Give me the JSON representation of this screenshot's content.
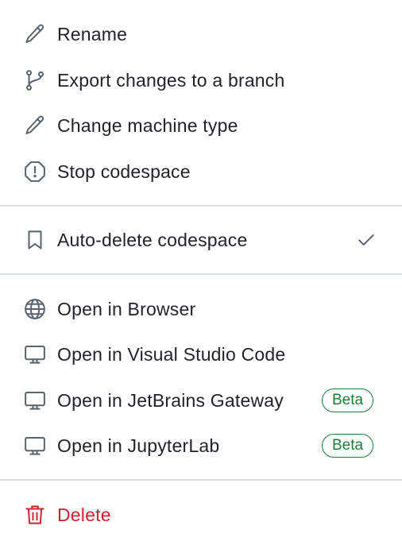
{
  "menu": {
    "group1": [
      {
        "label": "Rename",
        "icon": "pencil-icon"
      },
      {
        "label": "Export changes to a branch",
        "icon": "git-branch-icon"
      },
      {
        "label": "Change machine type",
        "icon": "pencil-icon"
      },
      {
        "label": "Stop codespace",
        "icon": "stop-octagon-icon"
      }
    ],
    "group2": [
      {
        "label": "Auto-delete codespace",
        "icon": "bookmark-icon",
        "checked": true
      }
    ],
    "group3": [
      {
        "label": "Open in Browser",
        "icon": "globe-icon"
      },
      {
        "label": "Open in Visual Studio Code",
        "icon": "desktop-icon"
      },
      {
        "label": "Open in JetBrains Gateway",
        "icon": "desktop-icon",
        "badge": "Beta"
      },
      {
        "label": "Open in JupyterLab",
        "icon": "desktop-icon",
        "badge": "Beta"
      }
    ],
    "group4": [
      {
        "label": "Delete",
        "icon": "trash-icon"
      }
    ]
  },
  "colors": {
    "text": "#1f2328",
    "icon": "#59636e",
    "divider": "#d8dee4",
    "badge": "#1a7f37",
    "danger": "#cf222e"
  }
}
